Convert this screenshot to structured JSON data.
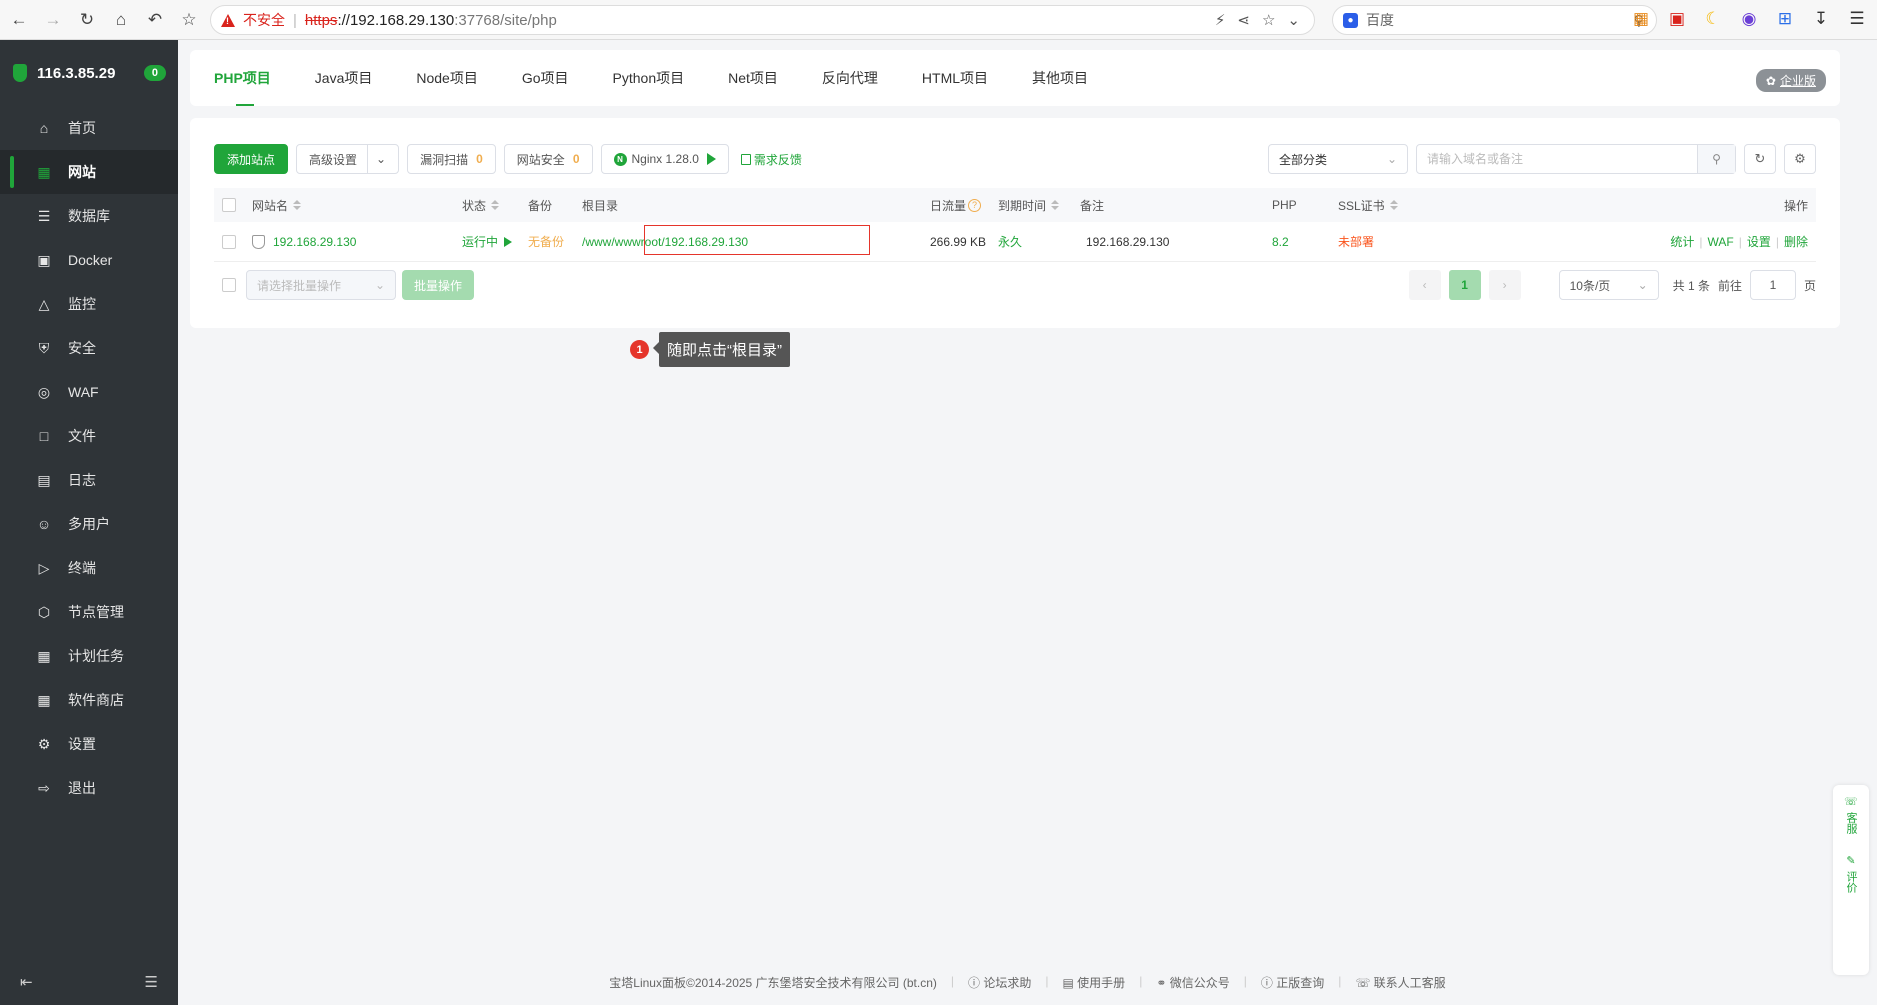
{
  "browser": {
    "insecure_label": "不安全",
    "url_proto": "https",
    "url_host": "://192.168.29.130",
    "url_rest": ":37768/site/php",
    "search_placeholder": "百度"
  },
  "sidebar": {
    "ip": "116.3.85.29",
    "badge": "0",
    "items": [
      {
        "label": "首页",
        "icon": "home-icon"
      },
      {
        "label": "网站",
        "icon": "globe-icon",
        "active": true
      },
      {
        "label": "数据库",
        "icon": "database-icon"
      },
      {
        "label": "Docker",
        "icon": "docker-icon"
      },
      {
        "label": "监控",
        "icon": "monitor-icon"
      },
      {
        "label": "安全",
        "icon": "shield-icon"
      },
      {
        "label": "WAF",
        "icon": "waf-icon"
      },
      {
        "label": "文件",
        "icon": "folder-icon"
      },
      {
        "label": "日志",
        "icon": "log-icon"
      },
      {
        "label": "多用户",
        "icon": "users-icon"
      },
      {
        "label": "终端",
        "icon": "terminal-icon"
      },
      {
        "label": "节点管理",
        "icon": "node-icon"
      },
      {
        "label": "计划任务",
        "icon": "calendar-icon"
      },
      {
        "label": "软件商店",
        "icon": "store-icon"
      },
      {
        "label": "设置",
        "icon": "gear-icon"
      },
      {
        "label": "退出",
        "icon": "logout-icon"
      }
    ]
  },
  "tabs": [
    "PHP项目",
    "Java项目",
    "Node项目",
    "Go项目",
    "Python项目",
    "Net项目",
    "反向代理",
    "HTML项目",
    "其他项目"
  ],
  "enterprise_label": "企业版",
  "toolbar": {
    "add_site": "添加站点",
    "advanced": "高级设置",
    "vuln_scan": "漏洞扫描",
    "vuln_count": "0",
    "site_security": "网站安全",
    "security_count": "0",
    "nginx": "Nginx 1.28.0",
    "feedback": "需求反馈",
    "category": "全部分类",
    "search_placeholder": "请输入域名或备注"
  },
  "table": {
    "headers": {
      "name": "网站名",
      "status": "状态",
      "backup": "备份",
      "root": "根目录",
      "traffic": "日流量",
      "expire": "到期时间",
      "remark": "备注",
      "php": "PHP",
      "ssl": "SSL证书",
      "ops": "操作"
    },
    "row": {
      "name": "192.168.29.130",
      "status": "运行中",
      "backup": "无备份",
      "root": "/www/wwwroot/192.168.29.130",
      "traffic": "266.99 KB",
      "expire": "永久",
      "remark": "192.168.29.130",
      "php": "8.2",
      "ssl": "未部署",
      "ops": [
        "统计",
        "WAF",
        "设置",
        "删除"
      ]
    }
  },
  "batch": {
    "select_placeholder": "请选择批量操作",
    "button": "批量操作"
  },
  "pager": {
    "current": "1",
    "per_page": "10条/页",
    "total": "共 1 条",
    "goto": "前往",
    "goto_value": "1",
    "page_unit": "页"
  },
  "callout": {
    "num": "1",
    "text": "随即点击“根目录”"
  },
  "float": {
    "service": "客服",
    "rate": "评价"
  },
  "footer": {
    "copyright": "宝塔Linux面板©2014-2025 广东堡塔安全技术有限公司 (bt.cn)",
    "links": [
      "论坛求助",
      "使用手册",
      "微信公众号",
      "正版查询",
      "联系人工客服"
    ]
  },
  "colors": {
    "accent": "#20a53a",
    "sidebar_bg": "#2f3438",
    "highlight": "#e5352b"
  }
}
